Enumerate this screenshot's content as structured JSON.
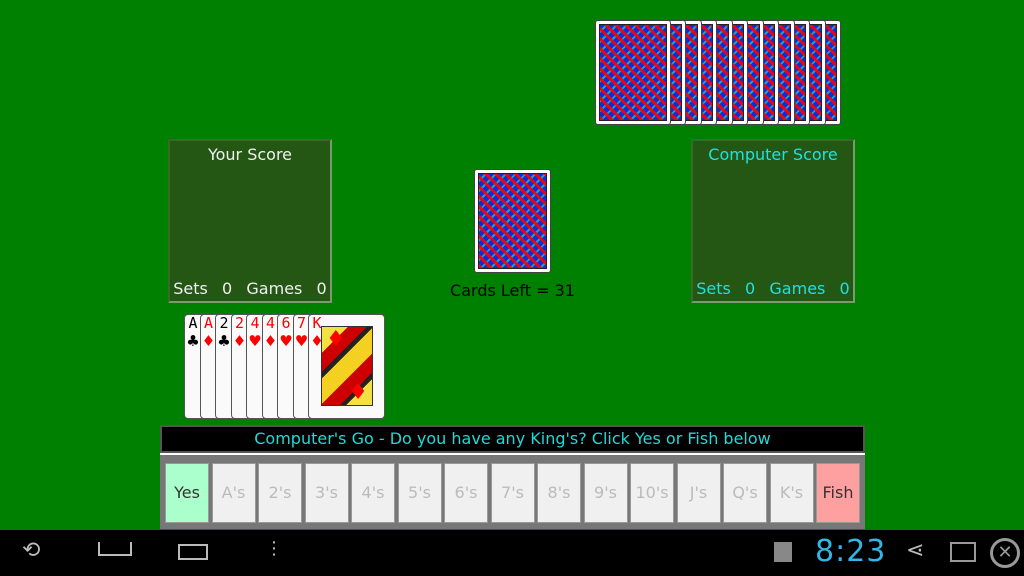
{
  "computer_hand": {
    "card_count": 12
  },
  "deck": {
    "cards_left_label": "Cards Left = 31"
  },
  "your_score": {
    "title": "Your Score",
    "sets_label": "Sets",
    "sets": "0",
    "games_label": "Games",
    "games": "0"
  },
  "computer_score": {
    "title": "Computer Score",
    "sets_label": "Sets",
    "sets": "0",
    "games_label": "Games",
    "games": "0"
  },
  "player_hand": [
    {
      "rank": "A",
      "suit": "♣",
      "color": "black"
    },
    {
      "rank": "A",
      "suit": "♦",
      "color": "red"
    },
    {
      "rank": "2",
      "suit": "♣",
      "color": "black"
    },
    {
      "rank": "2",
      "suit": "♦",
      "color": "red"
    },
    {
      "rank": "4",
      "suit": "♥",
      "color": "red"
    },
    {
      "rank": "4",
      "suit": "♦",
      "color": "red"
    },
    {
      "rank": "6",
      "suit": "♥",
      "color": "red"
    },
    {
      "rank": "7",
      "suit": "♥",
      "color": "red"
    },
    {
      "rank": "K",
      "suit": "♦",
      "color": "red"
    }
  ],
  "message": "Computer's Go - Do you have any King's? Click Yes or Fish below",
  "buttons": [
    {
      "label": "Yes",
      "state": "active",
      "color": "#aaffcc"
    },
    {
      "label": "A's",
      "state": "disabled"
    },
    {
      "label": "2's",
      "state": "disabled"
    },
    {
      "label": "3's",
      "state": "disabled"
    },
    {
      "label": "4's",
      "state": "disabled"
    },
    {
      "label": "5's",
      "state": "disabled"
    },
    {
      "label": "6's",
      "state": "disabled"
    },
    {
      "label": "7's",
      "state": "disabled"
    },
    {
      "label": "8's",
      "state": "disabled"
    },
    {
      "label": "9's",
      "state": "disabled"
    },
    {
      "label": "10's",
      "state": "disabled"
    },
    {
      "label": "J's",
      "state": "disabled"
    },
    {
      "label": "Q's",
      "state": "disabled"
    },
    {
      "label": "K's",
      "state": "disabled"
    },
    {
      "label": "Fish",
      "state": "active",
      "color": "#ffa0a0"
    }
  ],
  "status_bar": {
    "time": "8:23",
    "icons": [
      "back-icon",
      "home-icon",
      "recent-apps-icon",
      "menu-icon",
      "play-store-icon",
      "share-icon",
      "window-icon",
      "close-icon"
    ]
  },
  "colors": {
    "table": "#008000",
    "panel": "#245614",
    "message_text": "#22d8d8",
    "clock": "#33b5e5"
  }
}
